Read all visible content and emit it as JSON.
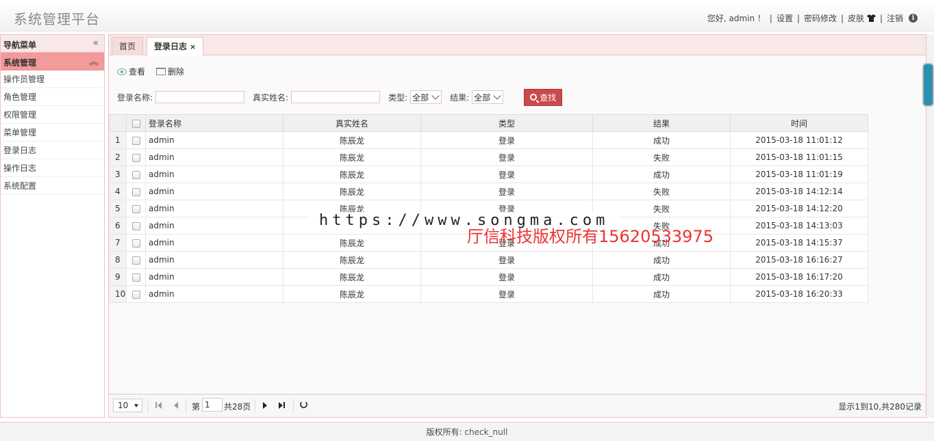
{
  "header": {
    "title": "系统管理平台",
    "greeting": "您好, admin ！",
    "links": {
      "settings": "设置",
      "password": "密码修改",
      "skin": "皮肤",
      "logout": "注销"
    }
  },
  "sidebar": {
    "title": "导航菜单",
    "group": "系统管理",
    "items": [
      "操作员管理",
      "角色管理",
      "权限管理",
      "菜单管理",
      "登录日志",
      "操作日志",
      "系统配置"
    ]
  },
  "tabs": [
    {
      "label": "首页"
    },
    {
      "label": "登录日志",
      "close": "×"
    }
  ],
  "toolbar": {
    "view": "查看",
    "delete": "删除"
  },
  "search": {
    "login_name_label": "登录名称:",
    "real_name_label": "真实姓名:",
    "type_label": "类型:",
    "type_value": "全部",
    "result_label": "结果:",
    "result_value": "全部",
    "find_button": "查找"
  },
  "grid": {
    "columns": [
      "登录名称",
      "真实姓名",
      "类型",
      "结果",
      "时间"
    ],
    "rows": [
      [
        "1",
        "admin",
        "陈辰龙",
        "登录",
        "成功",
        "2015-03-18 11:01:12"
      ],
      [
        "2",
        "admin",
        "陈辰龙",
        "登录",
        "失败",
        "2015-03-18 11:01:15"
      ],
      [
        "3",
        "admin",
        "陈辰龙",
        "登录",
        "成功",
        "2015-03-18 11:01:19"
      ],
      [
        "4",
        "admin",
        "陈辰龙",
        "登录",
        "失败",
        "2015-03-18 14:12:14"
      ],
      [
        "5",
        "admin",
        "陈辰龙",
        "登录",
        "失败",
        "2015-03-18 14:12:20"
      ],
      [
        "6",
        "admin",
        "",
        "",
        "失败",
        "2015-03-18 14:13:03"
      ],
      [
        "7",
        "admin",
        "陈辰龙",
        "登录",
        "成功",
        "2015-03-18 14:15:37"
      ],
      [
        "8",
        "admin",
        "陈辰龙",
        "登录",
        "成功",
        "2015-03-18 16:16:27"
      ],
      [
        "9",
        "admin",
        "陈辰龙",
        "登录",
        "成功",
        "2015-03-18 16:17:20"
      ],
      [
        "10",
        "admin",
        "陈辰龙",
        "登录",
        "成功",
        "2015-03-18 16:20:33"
      ]
    ]
  },
  "pager": {
    "page_size": "10",
    "page_prefix": "第",
    "current_page": "1",
    "total_pages": "共28页",
    "info": "显示1到10,共280记录"
  },
  "footer": {
    "label": "版权所有:",
    "value": "check_null"
  },
  "watermark": {
    "url": "https://www.songma.com",
    "text": "厅信科技版权所有15620533975"
  }
}
